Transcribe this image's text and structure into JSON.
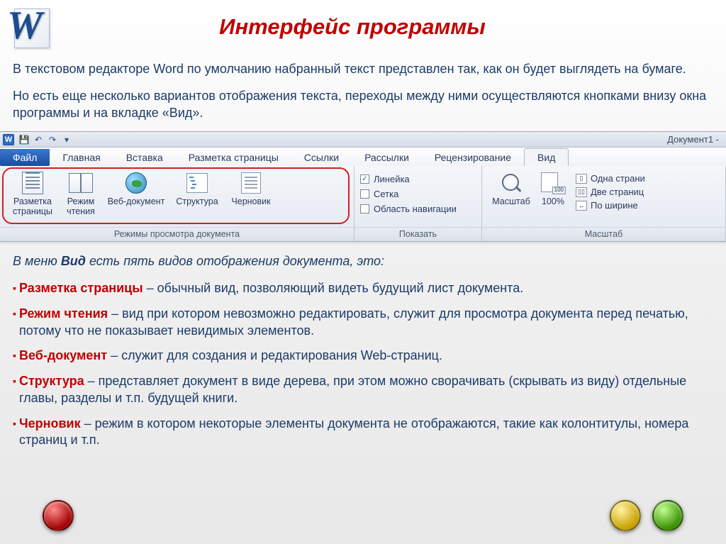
{
  "header": {
    "title": "Интерфейс программы"
  },
  "intro": {
    "p1": "В текстовом редакторе Word по умолчанию набранный текст представлен так, как он будет выглядеть на бумаге.",
    "p2": "Но есть еще несколько вариантов отображения текста, переходы между ними осуществляются кнопками внизу окна программы и на вкладке «Вид»."
  },
  "ribbon": {
    "doc_title": "Документ1 - ",
    "file_tab": "Файл",
    "tabs": [
      "Главная",
      "Вставка",
      "Разметка страницы",
      "Ссылки",
      "Рассылки",
      "Рецензирование",
      "Вид"
    ],
    "view_modes_group_label": "Режимы просмотра документа",
    "view_modes": {
      "page_layout": "Разметка страницы",
      "reading": "Режим чтения",
      "web": "Веб-документ",
      "outline": "Структура",
      "draft": "Черновик"
    },
    "show_group_label": "Показать",
    "show": {
      "ruler": "Линейка",
      "grid": "Сетка",
      "nav_pane": "Область навигации"
    },
    "zoom_group_label": "Масштаб",
    "zoom": {
      "zoom_btn": "Масштаб",
      "hundred": "100%",
      "one_page": "Одна страни",
      "two_pages": "Две страниц",
      "page_width": "По ширине"
    }
  },
  "after": {
    "intro_a": "В меню ",
    "intro_bold": "Вид",
    "intro_b": " есть пять видов отображения документа, это:",
    "items": [
      {
        "name": "Разметка страницы",
        "desc": " – обычный вид, позволяющий видеть будущий лист документа."
      },
      {
        "name": "Режим чтения",
        "desc": " – вид при котором невозможно редактировать, служит для просмотра документа перед печатью, потому что не показывает невидимых элементов."
      },
      {
        "name": "Веб-документ",
        "desc": " – служит для создания и редактирования Web-страниц."
      },
      {
        "name": "Структура",
        "desc": " – представляет документ в виде дерева, при этом можно сворачивать (скрывать из виду) отдельные главы, разделы и т.п. будущей книги."
      },
      {
        "name": "Черновик",
        "desc": " – режим в котором некоторые элементы документа не отображаются, такие как колонтитулы, номера страниц и т.п."
      }
    ]
  }
}
